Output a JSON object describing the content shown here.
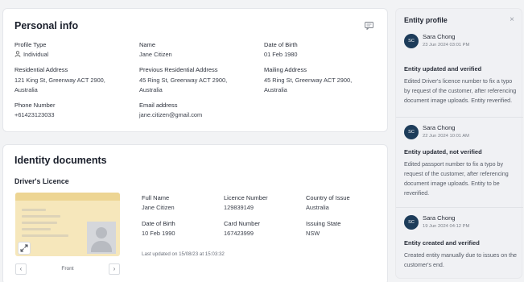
{
  "personal": {
    "title": "Personal info",
    "profile_type_label": "Profile Type",
    "profile_type_value": "Individual",
    "name_label": "Name",
    "name_value": "Jane Citizen",
    "dob_label": "Date of Birth",
    "dob_value": "01 Feb 1980",
    "res_addr_label": "Residential Address",
    "res_addr_line1": "121 King St, Greenway ACT 2900,",
    "res_addr_line2": "Australia",
    "prev_addr_label": "Previous Residential Address",
    "prev_addr_line1": "45 Ring St, Greenway ACT 2900,",
    "prev_addr_line2": "Australia",
    "mail_addr_label": "Mailing Address",
    "mail_addr_line1": "45 Ring St, Greenway ACT 2900,",
    "mail_addr_line2": "Australia",
    "phone_label": "Phone Number",
    "phone_value": "+61423123033",
    "email_label": "Email address",
    "email_value": "jane.citizen@gmail.com"
  },
  "identity": {
    "title": "Identity documents",
    "doc_title": "Driver's Licence",
    "full_name_label": "Full Name",
    "full_name_value": "Jane Citizen",
    "licence_number_label": "Licence Number",
    "licence_number_value": "129839149",
    "country_label": "Country of Issue",
    "country_value": "Australia",
    "dob_label": "Date of Birth",
    "dob_value": "10 Feb 1990",
    "card_number_label": "Card Number",
    "card_number_value": "167423999",
    "issuing_state_label": "Issuing State",
    "issuing_state_value": "NSW",
    "last_updated": "Last updated on 15/08/23 at 15:03:32",
    "pager_label": "Front",
    "prev_glyph": "‹",
    "next_glyph": "›"
  },
  "entity": {
    "title": "Entity profile",
    "close_glyph": "×",
    "entries": [
      {
        "initials": "SC",
        "name": "Sara Chong",
        "date": "23 Jun 2024 03:01 PM",
        "heading": "Entity updated and verified",
        "body": "Edited Driver's licence number to fix a typo by request of the customer, after referencing document image uploads. Entity reverified."
      },
      {
        "initials": "SC",
        "name": "Sara Chong",
        "date": "22 Jun 2024 10:01 AM",
        "heading": "Entity updated, not verified",
        "body": "Edited passport number to fix a typo by request of the customer, after referencing document image uploads. Entity to be reverified."
      },
      {
        "initials": "SC",
        "name": "Sara Chong",
        "date": "19 Jun 2024 04:12 PM",
        "heading": "Entity created and verified",
        "body": "Created entity manually due to issues on the customer's end."
      }
    ]
  },
  "icons": {
    "chat": "chat-bubble-icon",
    "person": "person-icon",
    "expand": "expand-icon"
  },
  "colors": {
    "avatar": "#1d3c5a",
    "licence_bg": "#f6e7bb"
  }
}
